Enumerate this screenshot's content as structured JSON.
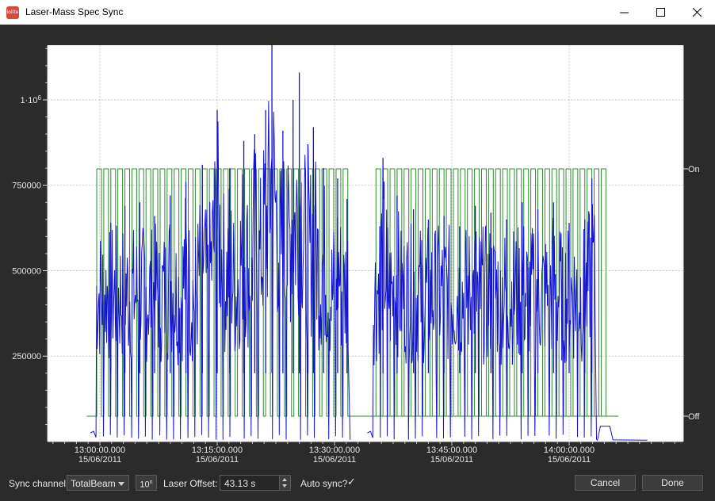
{
  "window": {
    "title": "Laser-Mass Spec Sync",
    "icon": "app-logo-icon"
  },
  "chart_data": {
    "type": "line",
    "title": "",
    "xlabel": "",
    "ylabel": "",
    "grid": true,
    "ylim": [
      0,
      1160000
    ],
    "left_ticks": [
      {
        "value": 250000,
        "label": "250000"
      },
      {
        "value": 500000,
        "label": "500000"
      },
      {
        "value": 750000,
        "label": "750000"
      },
      {
        "value": 1000000,
        "label": "1·10",
        "exp": "6"
      }
    ],
    "right_ticks": [
      {
        "value": 0,
        "label": "Off"
      },
      {
        "value": 1,
        "label": "On"
      }
    ],
    "x_ticks": [
      {
        "time": "13:00:00.000",
        "date": "15/06/2011"
      },
      {
        "time": "13:15:00.000",
        "date": "15/06/2011"
      },
      {
        "time": "13:30:00.000",
        "date": "15/06/2011"
      },
      {
        "time": "13:45:00.000",
        "date": "15/06/2011"
      },
      {
        "time": "14:00:00.000",
        "date": "15/06/2011"
      }
    ],
    "series": [
      {
        "name": "TotalBeam",
        "color": "#1414d2",
        "axis": "left"
      },
      {
        "name": "",
        "color": "#2e8b2e",
        "axis": "right"
      }
    ],
    "laser_segments": [
      {
        "start_min": -1.7,
        "end_min": 64.7,
        "first_on_min": -0.4,
        "period_min": 0.9,
        "on_min": 0.6,
        "count": 36
      },
      {
        "start_min": 34.3,
        "end_min": 66.3,
        "first_on_min": 35.3,
        "period_min": 0.9,
        "on_min": 0.6,
        "count": 33
      }
    ],
    "signal_peaks": [
      {
        "time_min": 1.4,
        "value": 640000
      },
      {
        "time_min": 3.2,
        "value": 690000
      },
      {
        "time_min": 5.1,
        "value": 700000
      },
      {
        "time_min": 7.0,
        "value": 660000
      },
      {
        "time_min": 9.0,
        "value": 720000
      },
      {
        "time_min": 11.0,
        "value": 760000
      },
      {
        "time_min": 13.1,
        "value": 810000
      },
      {
        "time_min": 15.0,
        "value": 970000
      },
      {
        "time_min": 16.6,
        "value": 800000
      },
      {
        "time_min": 18.4,
        "value": 880000
      },
      {
        "time_min": 19.8,
        "value": 900000
      },
      {
        "time_min": 21.2,
        "value": 970000
      },
      {
        "time_min": 22.0,
        "value": 1160000
      },
      {
        "time_min": 23.4,
        "value": 910000
      },
      {
        "time_min": 24.7,
        "value": 1000000
      },
      {
        "time_min": 25.5,
        "value": 1080000
      },
      {
        "time_min": 26.6,
        "value": 870000
      },
      {
        "time_min": 27.3,
        "value": 920000
      },
      {
        "time_min": 28.6,
        "value": 800000
      },
      {
        "time_min": 30.4,
        "value": 770000
      },
      {
        "time_min": 31.6,
        "value": 710000
      },
      {
        "time_min": 36.2,
        "value": 830000
      },
      {
        "time_min": 38.0,
        "value": 720000
      },
      {
        "time_min": 40.1,
        "value": 680000
      },
      {
        "time_min": 42.0,
        "value": 650000
      },
      {
        "time_min": 44.0,
        "value": 660000
      },
      {
        "time_min": 46.0,
        "value": 630000
      },
      {
        "time_min": 48.0,
        "value": 690000
      },
      {
        "time_min": 50.0,
        "value": 670000
      },
      {
        "time_min": 52.0,
        "value": 650000
      },
      {
        "time_min": 54.0,
        "value": 700000
      },
      {
        "time_min": 56.0,
        "value": 680000
      },
      {
        "time_min": 58.0,
        "value": 700000
      },
      {
        "time_min": 60.0,
        "value": 640000
      },
      {
        "time_min": 62.0,
        "value": 650000
      },
      {
        "time_min": 62.9,
        "value": 770000
      }
    ]
  },
  "controls": {
    "sync_channel_label": "Sync channel:",
    "sync_channel_value": "TotalBeam",
    "exp_button_label": "10",
    "exp_button_sup": "n",
    "laser_offset_label": "Laser Offset:",
    "laser_offset_value": "43.13 s",
    "auto_sync_label": "Auto sync?",
    "auto_sync_checked": true,
    "auto_sync_mark": "✓",
    "cancel_label": "Cancel",
    "done_label": "Done"
  }
}
